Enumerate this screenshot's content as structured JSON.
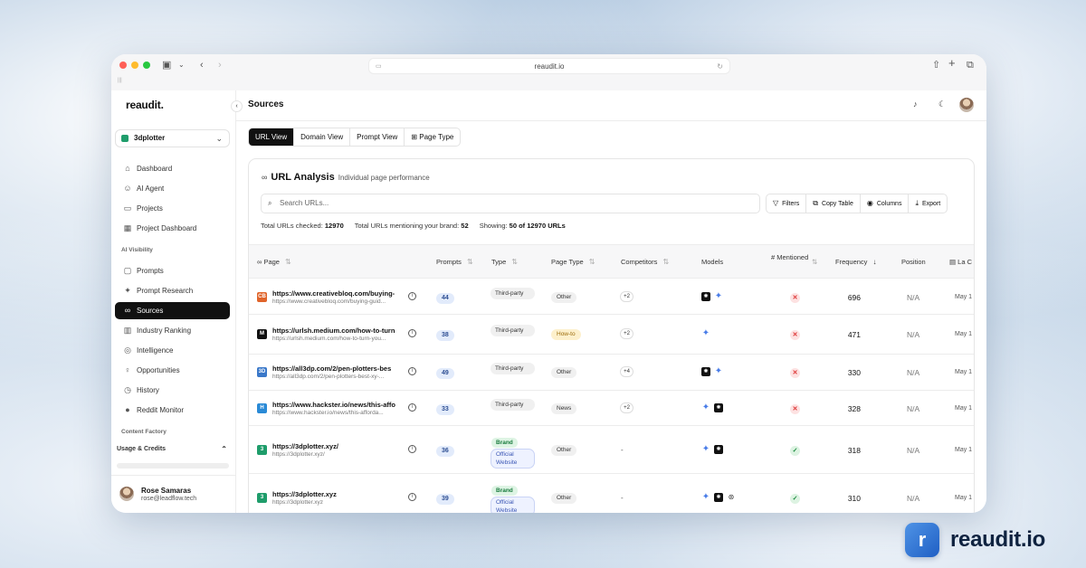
{
  "browser": {
    "url": "reaudit.io"
  },
  "app": {
    "logo": "reaudit.",
    "project": "3dplotter",
    "page_title": "Sources",
    "nav": [
      {
        "label": "Dashboard",
        "icon": "home-icon"
      },
      {
        "label": "AI Agent",
        "icon": "robot-icon"
      },
      {
        "label": "Projects",
        "icon": "folder-icon"
      },
      {
        "label": "Project Dashboard",
        "icon": "layout-icon"
      }
    ],
    "section_ai_visibility": "AI Visibility",
    "nav_ai": [
      {
        "label": "Prompts",
        "icon": "message-icon"
      },
      {
        "label": "Prompt Research",
        "icon": "sparkle-icon"
      },
      {
        "label": "Sources",
        "icon": "link-icon",
        "active": true
      },
      {
        "label": "Industry Ranking",
        "icon": "bar-chart-icon"
      },
      {
        "label": "Intelligence",
        "icon": "brain-icon"
      },
      {
        "label": "Opportunities",
        "icon": "lightbulb-icon"
      },
      {
        "label": "History",
        "icon": "clock-icon"
      },
      {
        "label": "Reddit Monitor",
        "icon": "reddit-icon"
      }
    ],
    "section_content_factory": "Content Factory",
    "usage_label": "Usage & Credits",
    "user": {
      "name": "Rose Samaras",
      "email": "rose@leadflow.tech"
    }
  },
  "views": [
    "URL View",
    "Domain View",
    "Prompt View",
    "Page Type"
  ],
  "active_view": "URL View",
  "card": {
    "title": "URL Analysis",
    "subtitle": "Individual page performance",
    "search_placeholder": "Search URLs...",
    "tools": [
      "Filters",
      "Copy Table",
      "Columns",
      "Export"
    ],
    "stats": {
      "checked_label": "Total URLs checked:",
      "checked_value": "12970",
      "mentioning_label": "Total URLs mentioning your brand:",
      "mentioning_value": "52",
      "showing_label": "Showing:",
      "showing_value": "50 of 12970 URLs"
    }
  },
  "table": {
    "columns": {
      "page": "Page",
      "prompts": "Prompts",
      "type": "Type",
      "page_type": "Page Type",
      "competitors": "Competitors",
      "models": "Models",
      "mentioned": "# Mentioned",
      "frequency": "Frequency",
      "position": "Position",
      "last": "La C"
    },
    "rows": [
      {
        "favicon": "CB",
        "favicon_color": "#e0642a",
        "url": "https://www.creativebloq.com/buying-",
        "url_sub": "https://www.creativebloq.com/buying-guid...",
        "prompts": "44",
        "type": "Third-party",
        "page_type": "Other",
        "competitors": "+2",
        "models": [
          "gpt",
          "gemini"
        ],
        "mentioned": "✕",
        "frequency": "696",
        "position": "N/A",
        "last": "May 1"
      },
      {
        "favicon": "M",
        "favicon_color": "#111111",
        "url": "https://urlsh.medium.com/how-to-turn",
        "url_sub": "https://urlsh.medium.com/how-to-turn-you...",
        "prompts": "38",
        "type": "Third-party",
        "page_type": "How-to",
        "competitors": "+2",
        "models": [
          "gemini"
        ],
        "mentioned": "✕",
        "frequency": "471",
        "position": "N/A",
        "last": "May 1"
      },
      {
        "favicon": "3D",
        "favicon_color": "#3a78c9",
        "url": "https://all3dp.com/2/pen-plotters-bes",
        "url_sub": "https://all3dp.com/2/pen-plotters-best-xy-...",
        "prompts": "49",
        "type": "Third-party",
        "page_type": "Other",
        "competitors": "+4",
        "models": [
          "gpt",
          "gemini"
        ],
        "mentioned": "✕",
        "frequency": "330",
        "position": "N/A",
        "last": "May 1"
      },
      {
        "favicon": "H",
        "favicon_color": "#2a8ad6",
        "url": "https://www.hackster.io/news/this-affo",
        "url_sub": "https://www.hackster.io/news/this-afforda...",
        "prompts": "33",
        "type": "Third-party",
        "page_type": "News",
        "competitors": "+2",
        "models": [
          "gemini",
          "gpt"
        ],
        "mentioned": "✕",
        "frequency": "328",
        "position": "N/A",
        "last": "May 1"
      },
      {
        "favicon": "3",
        "favicon_color": "#1f9d6b",
        "url": "https://3dplotter.xyz/",
        "url_sub": "https://3dplotter.xyz/",
        "prompts": "36",
        "brand": "Brand",
        "type": "Official Website",
        "page_type": "Other",
        "competitors": "-",
        "models": [
          "gemini",
          "gpt"
        ],
        "mentioned": "✓",
        "frequency": "318",
        "position": "N/A",
        "last": "May 1"
      },
      {
        "favicon": "3",
        "favicon_color": "#1f9d6b",
        "url": "https://3dplotter.xyz",
        "url_sub": "https://3dplotter.xyz",
        "prompts": "39",
        "brand": "Brand",
        "type": "Official Website",
        "page_type": "Other",
        "competitors": "-",
        "models": [
          "gemini",
          "gpt",
          "perplexity"
        ],
        "mentioned": "✓",
        "frequency": "310",
        "position": "N/A",
        "last": "May 1"
      }
    ]
  },
  "branding": {
    "badge_glyph": "r",
    "text": "reaudit.io"
  }
}
